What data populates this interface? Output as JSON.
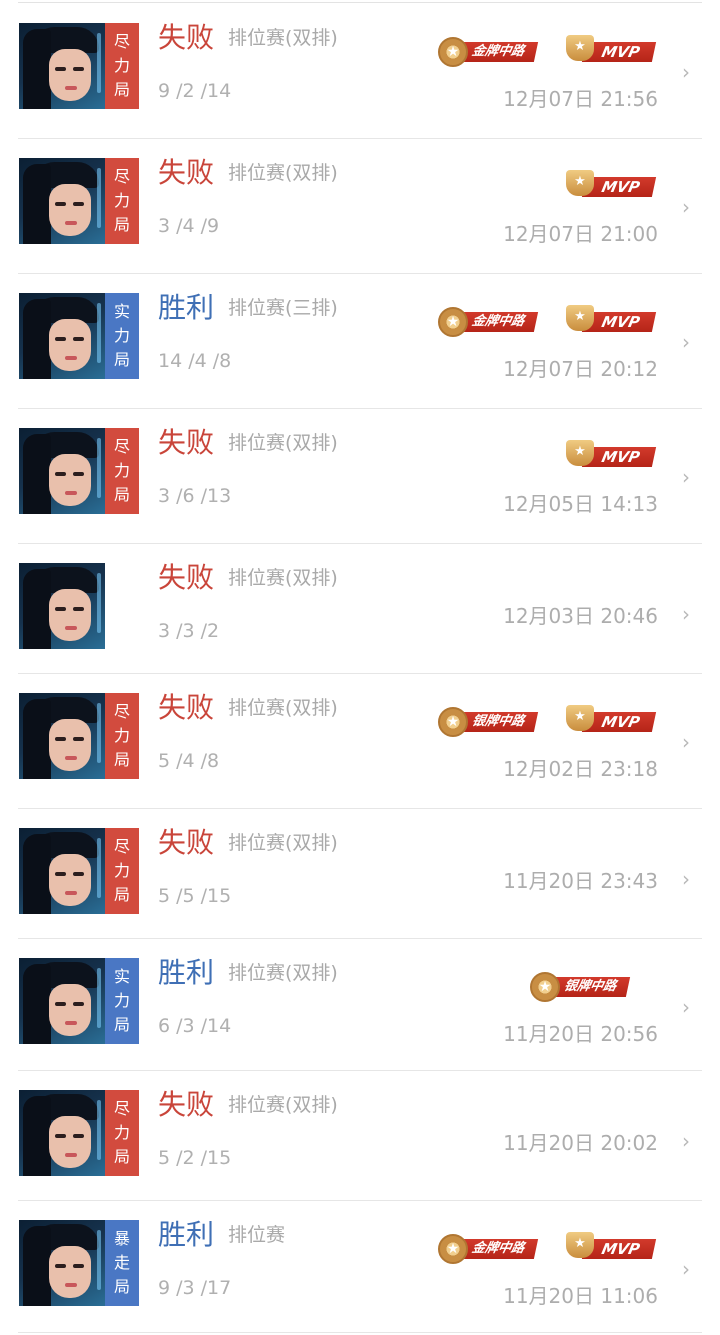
{
  "rows": [
    {
      "tag": [
        "尽",
        "力",
        "局"
      ],
      "tag_color": "red",
      "result": "失败",
      "result_type": "loss",
      "mode": "排位赛(双排)",
      "kda": "9 /2 /14",
      "time": "12月07日 21:56",
      "badges": [
        "金牌中路",
        "MVP"
      ]
    },
    {
      "tag": [
        "尽",
        "力",
        "局"
      ],
      "tag_color": "red",
      "result": "失败",
      "result_type": "loss",
      "mode": "排位赛(双排)",
      "kda": "3 /4 /9",
      "time": "12月07日 21:00",
      "badges": [
        "MVP"
      ]
    },
    {
      "tag": [
        "实",
        "力",
        "局"
      ],
      "tag_color": "blue",
      "result": "胜利",
      "result_type": "win",
      "mode": "排位赛(三排)",
      "kda": "14 /4 /8",
      "time": "12月07日 20:12",
      "badges": [
        "金牌中路",
        "MVP"
      ]
    },
    {
      "tag": [
        "尽",
        "力",
        "局"
      ],
      "tag_color": "red",
      "result": "失败",
      "result_type": "loss",
      "mode": "排位赛(双排)",
      "kda": "3 /6 /13",
      "time": "12月05日 14:13",
      "badges": [
        "MVP"
      ]
    },
    {
      "tag": [],
      "tag_color": "none",
      "result": "失败",
      "result_type": "loss",
      "mode": "排位赛(双排)",
      "kda": "3 /3 /2",
      "time": "12月03日 20:46",
      "badges": []
    },
    {
      "tag": [
        "尽",
        "力",
        "局"
      ],
      "tag_color": "red",
      "result": "失败",
      "result_type": "loss",
      "mode": "排位赛(双排)",
      "kda": "5 /4 /8",
      "time": "12月02日 23:18",
      "badges": [
        "银牌中路",
        "MVP"
      ]
    },
    {
      "tag": [
        "尽",
        "力",
        "局"
      ],
      "tag_color": "red",
      "result": "失败",
      "result_type": "loss",
      "mode": "排位赛(双排)",
      "kda": "5 /5 /15",
      "time": "11月20日 23:43",
      "badges": []
    },
    {
      "tag": [
        "实",
        "力",
        "局"
      ],
      "tag_color": "blue",
      "result": "胜利",
      "result_type": "win",
      "mode": "排位赛(双排)",
      "kda": "6 /3 /14",
      "time": "11月20日 20:56",
      "badges": [
        "银牌中路"
      ]
    },
    {
      "tag": [
        "尽",
        "力",
        "局"
      ],
      "tag_color": "red",
      "result": "失败",
      "result_type": "loss",
      "mode": "排位赛(双排)",
      "kda": "5 /2 /15",
      "time": "11月20日 20:02",
      "badges": []
    },
    {
      "tag": [
        "暴",
        "走",
        "局"
      ],
      "tag_color": "blue",
      "result": "胜利",
      "result_type": "win",
      "mode": "排位赛",
      "kda": "9 /3 /17",
      "time": "11月20日 11:06",
      "badges": [
        "金牌中路",
        "MVP"
      ]
    }
  ],
  "chevron_glyph": "›",
  "medal_star": "★",
  "colors": {
    "loss": "#c9453a",
    "win": "#3f6fb5",
    "tag_red": "#d24b3e",
    "tag_blue": "#4a77c4"
  }
}
